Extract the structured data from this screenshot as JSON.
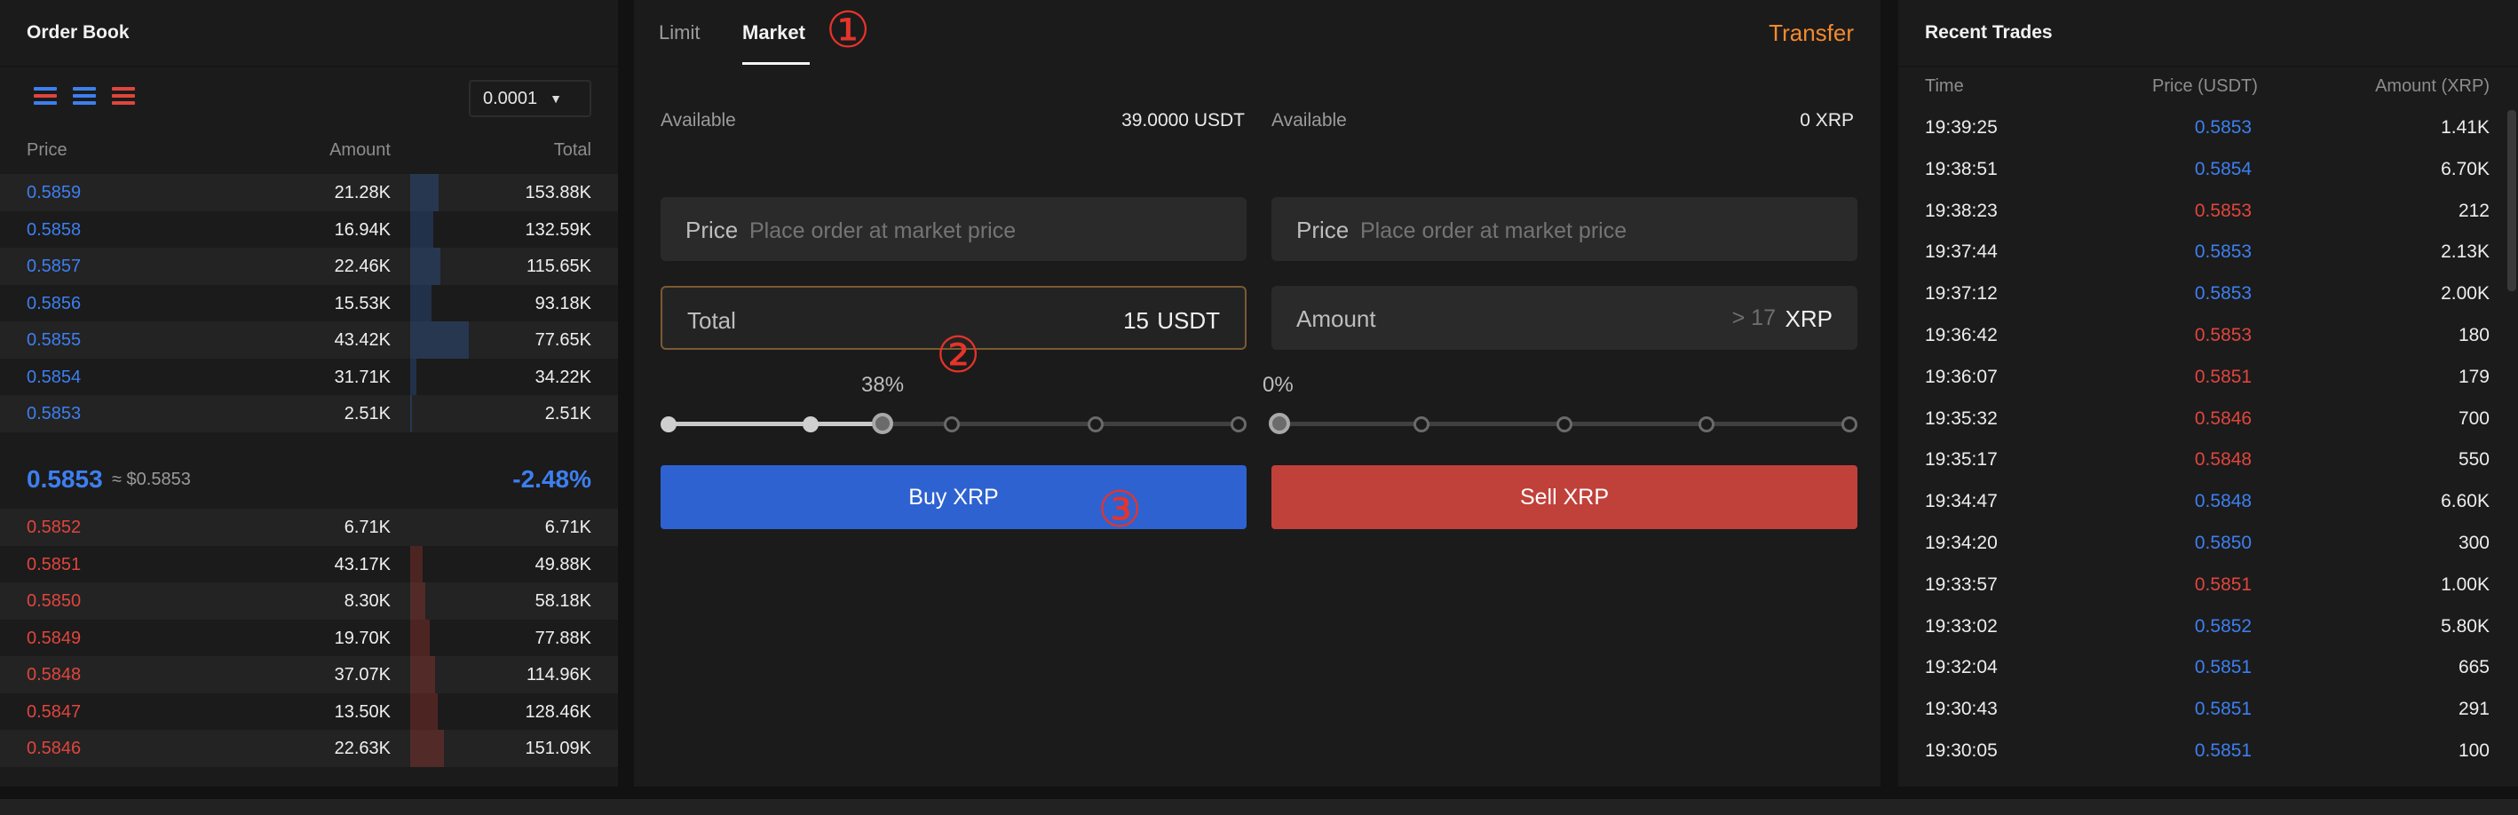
{
  "order_book": {
    "title": "Order Book",
    "precision": "0.0001",
    "headers": {
      "price": "Price",
      "amount": "Amount",
      "total": "Total"
    },
    "asks": [
      {
        "price": "0.5859",
        "amount": "21.28K",
        "total": "153.88K",
        "depth": 0.27
      },
      {
        "price": "0.5858",
        "amount": "16.94K",
        "total": "132.59K",
        "depth": 0.22
      },
      {
        "price": "0.5857",
        "amount": "22.46K",
        "total": "115.65K",
        "depth": 0.28
      },
      {
        "price": "0.5856",
        "amount": "15.53K",
        "total": "93.18K",
        "depth": 0.2
      },
      {
        "price": "0.5855",
        "amount": "43.42K",
        "total": "77.65K",
        "depth": 0.55
      },
      {
        "price": "0.5854",
        "amount": "31.71K",
        "total": "34.22K",
        "depth": 0.06
      },
      {
        "price": "0.5853",
        "amount": "2.51K",
        "total": "2.51K",
        "depth": 0.02
      }
    ],
    "mid": {
      "price": "0.5853",
      "usd": "≈ $0.5853",
      "change": "-2.48%"
    },
    "bids": [
      {
        "price": "0.5852",
        "amount": "6.71K",
        "total": "6.71K",
        "depth": 0.0
      },
      {
        "price": "0.5851",
        "amount": "43.17K",
        "total": "49.88K",
        "depth": 0.12
      },
      {
        "price": "0.5850",
        "amount": "8.30K",
        "total": "58.18K",
        "depth": 0.14
      },
      {
        "price": "0.5849",
        "amount": "19.70K",
        "total": "77.88K",
        "depth": 0.18
      },
      {
        "price": "0.5848",
        "amount": "37.07K",
        "total": "114.96K",
        "depth": 0.23
      },
      {
        "price": "0.5847",
        "amount": "13.50K",
        "total": "128.46K",
        "depth": 0.26
      },
      {
        "price": "0.5846",
        "amount": "22.63K",
        "total": "151.09K",
        "depth": 0.32
      }
    ],
    "colors": {
      "buy": "#3d7ff0",
      "sell": "#e0453d"
    }
  },
  "trade": {
    "tabs": [
      {
        "label": "Limit"
      },
      {
        "label": "Market"
      }
    ],
    "active_tab": "Market",
    "transfer": "Transfer",
    "annotations": [
      "①",
      "②",
      "③"
    ],
    "buy": {
      "available_label": "Available",
      "available_value": "39.0000  USDT",
      "price_label": "Price",
      "price_placeholder": "Place order at market price",
      "total_label": "Total",
      "total_value": "15",
      "total_unit": "USDT",
      "percent": "38%",
      "button": "Buy XRP"
    },
    "sell": {
      "available_label": "Available",
      "available_value": "0  XRP",
      "price_label": "Price",
      "price_placeholder": "Place order at market price",
      "amount_label": "Amount",
      "amount_hint": "> 17",
      "amount_unit": "XRP",
      "percent": "0%",
      "button": "Sell XRP"
    }
  },
  "recent_trades": {
    "title": "Recent Trades",
    "headers": {
      "time": "Time",
      "price": "Price (USDT)",
      "amount": "Amount (XRP)"
    },
    "rows": [
      {
        "time": "19:39:25",
        "price": "0.5853",
        "amount": "1.41K",
        "side": "buy"
      },
      {
        "time": "19:38:51",
        "price": "0.5854",
        "amount": "6.70K",
        "side": "buy"
      },
      {
        "time": "19:38:23",
        "price": "0.5853",
        "amount": "212",
        "side": "sell"
      },
      {
        "time": "19:37:44",
        "price": "0.5853",
        "amount": "2.13K",
        "side": "buy"
      },
      {
        "time": "19:37:12",
        "price": "0.5853",
        "amount": "2.00K",
        "side": "buy"
      },
      {
        "time": "19:36:42",
        "price": "0.5853",
        "amount": "180",
        "side": "sell"
      },
      {
        "time": "19:36:07",
        "price": "0.5851",
        "amount": "179",
        "side": "sell"
      },
      {
        "time": "19:35:32",
        "price": "0.5846",
        "amount": "700",
        "side": "sell"
      },
      {
        "time": "19:35:17",
        "price": "0.5848",
        "amount": "550",
        "side": "sell"
      },
      {
        "time": "19:34:47",
        "price": "0.5848",
        "amount": "6.60K",
        "side": "buy"
      },
      {
        "time": "19:34:20",
        "price": "0.5850",
        "amount": "300",
        "side": "buy"
      },
      {
        "time": "19:33:57",
        "price": "0.5851",
        "amount": "1.00K",
        "side": "sell"
      },
      {
        "time": "19:33:02",
        "price": "0.5852",
        "amount": "5.80K",
        "side": "buy"
      },
      {
        "time": "19:32:04",
        "price": "0.5851",
        "amount": "665",
        "side": "buy"
      },
      {
        "time": "19:30:43",
        "price": "0.5851",
        "amount": "291",
        "side": "buy"
      },
      {
        "time": "19:30:05",
        "price": "0.5851",
        "amount": "100",
        "side": "buy"
      }
    ]
  }
}
